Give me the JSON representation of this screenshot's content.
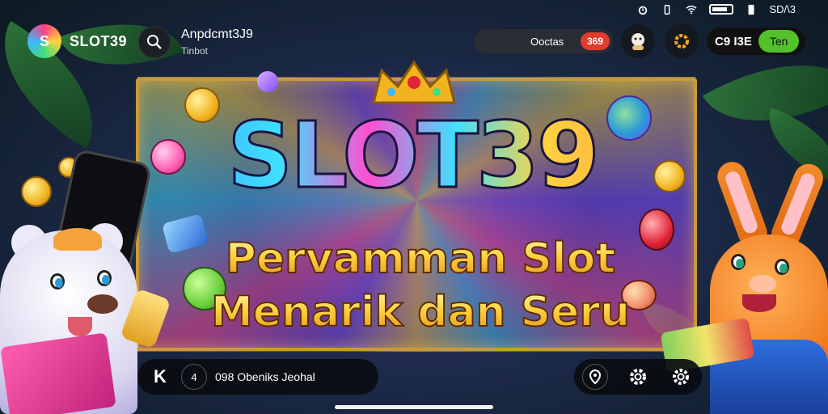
{
  "status_bar": {
    "icons": [
      "alarm-icon",
      "vibrate-icon",
      "wifi-icon",
      "battery-icon",
      "sd-icon"
    ],
    "right_text": "SD/\\3"
  },
  "header": {
    "logo_text": "S",
    "brand": "SLOT39",
    "app_title": "Anpdcmt3J9",
    "app_subtitle": "Tinbot",
    "pill_text": "Ooctas",
    "pill_badge": "369",
    "balance": "C9 I3E",
    "balance_button": "Ten"
  },
  "hero": {
    "title": "SLOT39",
    "subtitle_line1": "Pervamman Slot",
    "subtitle_line2": "Menarik dan Seru"
  },
  "bottom_bar": {
    "label": "098 Obeniks Jeohal",
    "back_glyph": "K",
    "mid_glyph": "4"
  },
  "colors": {
    "accent_red": "#e23b2e",
    "accent_green": "#53c12a",
    "gold": "#ffd23f"
  }
}
